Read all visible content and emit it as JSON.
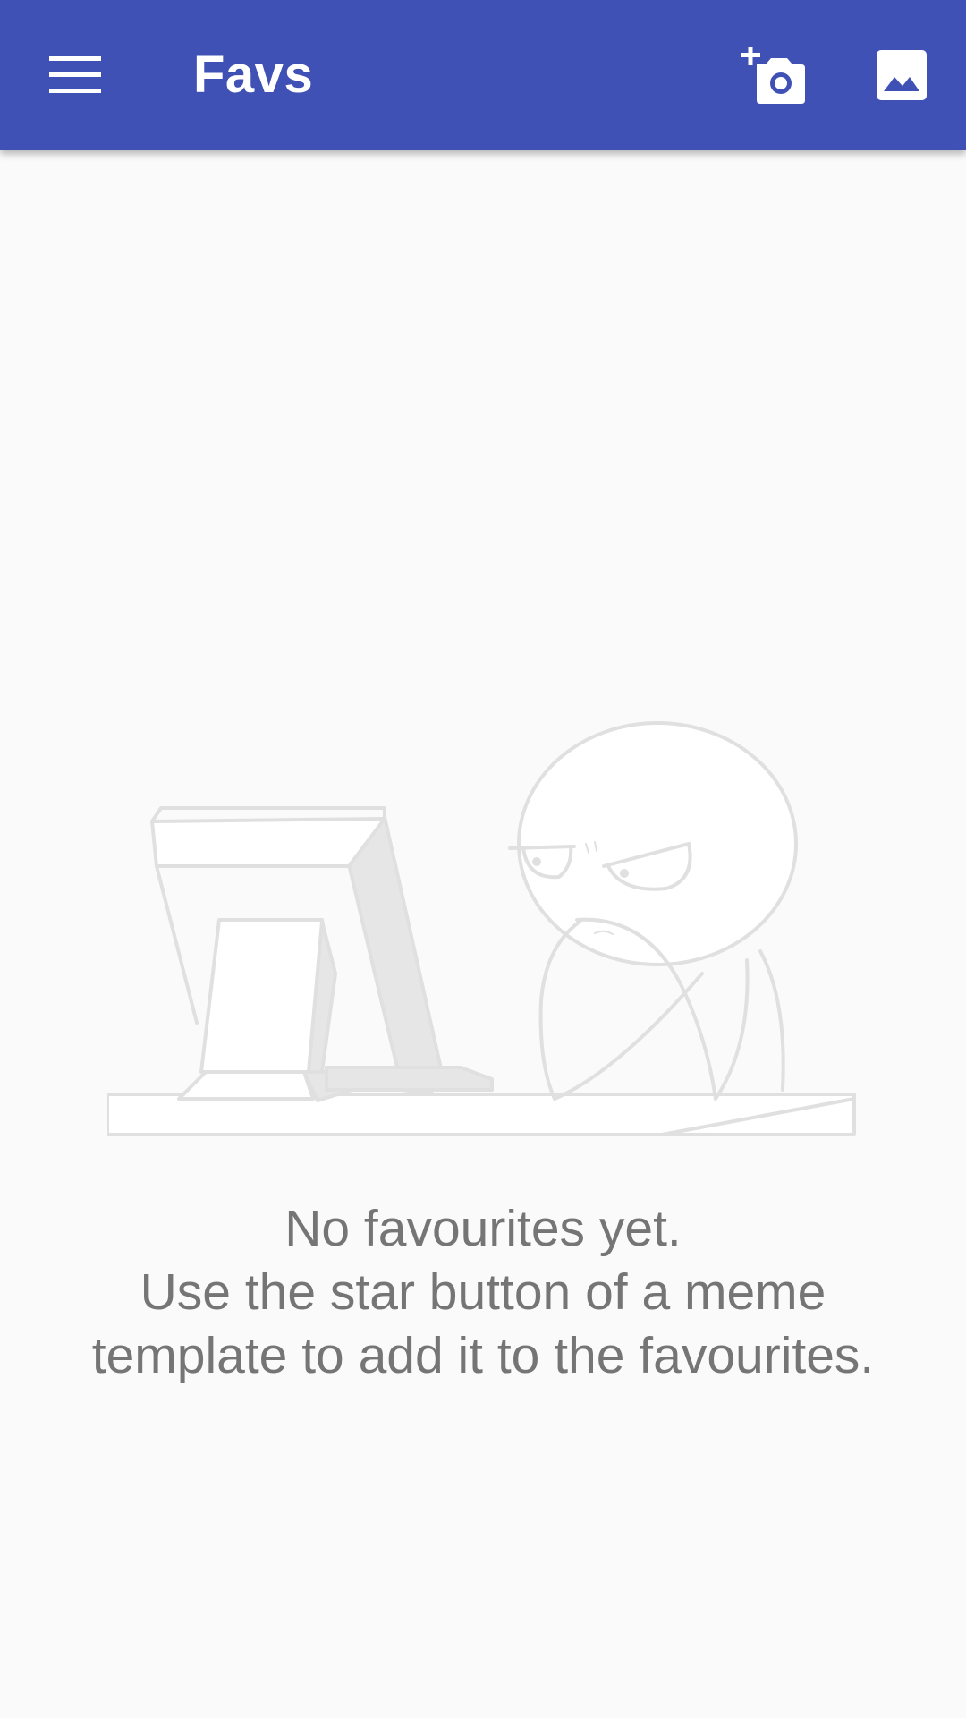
{
  "toolbar": {
    "title": "Favs",
    "menu_icon": "hamburger-menu-icon",
    "actions": [
      {
        "icon": "add-photo-camera-icon"
      },
      {
        "icon": "image-gallery-icon"
      }
    ],
    "background_color": "#3f51b5",
    "foreground_color": "#ffffff"
  },
  "empty_state": {
    "illustration": "computer-guy-meme-icon",
    "line1": "No favourites yet.",
    "line2": "Use the star button of a meme template to add it to the favourites.",
    "text_color": "#757575"
  }
}
